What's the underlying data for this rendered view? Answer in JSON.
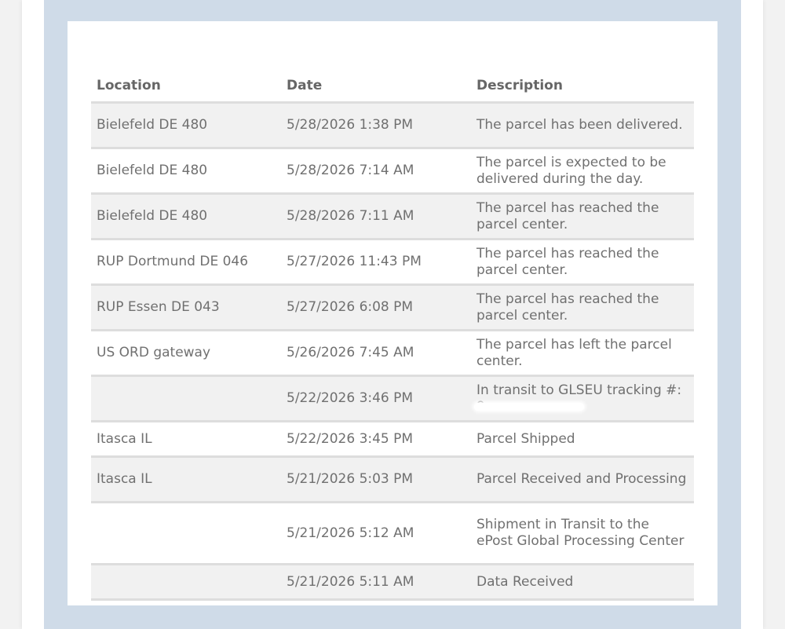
{
  "tracking_table": {
    "headers": {
      "location": "Location",
      "date": "Date",
      "description": "Description"
    },
    "rows": [
      {
        "location": "Bielefeld DE 480",
        "date": "5/28/2026 1:38 PM",
        "description": "The parcel has been delivered."
      },
      {
        "location": "Bielefeld DE 480",
        "date": "5/28/2026 7:14 AM",
        "description": "The parcel is expected to be delivered during the day."
      },
      {
        "location": "Bielefeld DE 480",
        "date": "5/28/2026 7:11 AM",
        "description": "The parcel has reached the parcel center."
      },
      {
        "location": "RUP Dortmund DE 046",
        "date": "5/27/2026 11:43 PM",
        "description": "The parcel has reached the parcel center."
      },
      {
        "location": "RUP Essen DE 043",
        "date": "5/27/2026 6:08 PM",
        "description": "The parcel has reached the parcel center."
      },
      {
        "location": "US ORD gateway",
        "date": "5/26/2026 7:45 AM",
        "description": "The parcel has left the parcel center."
      },
      {
        "location": "",
        "date": "5/22/2026 3:46 PM",
        "description": "In transit to GLSEU tracking #: 9"
      },
      {
        "location": "Itasca IL",
        "date": "5/22/2026 3:45 PM",
        "description": "Parcel Shipped"
      },
      {
        "location": "Itasca IL",
        "date": "5/21/2026 5:03 PM",
        "description": "Parcel Received and Processing"
      },
      {
        "location": "",
        "date": "5/21/2026 5:12 AM",
        "description": "Shipment in Transit to the ePost Global Processing Center"
      },
      {
        "location": "",
        "date": "5/21/2026 5:11 AM",
        "description": "Data Received"
      }
    ]
  }
}
